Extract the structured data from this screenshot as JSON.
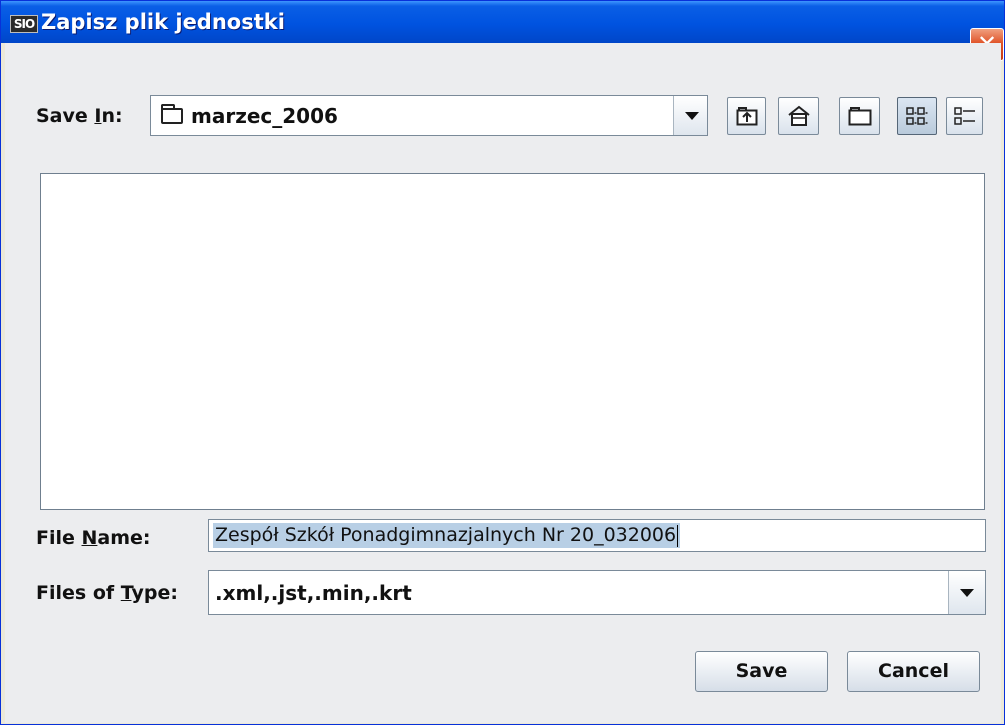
{
  "window": {
    "title": "Zapisz plik jednostki",
    "app_icon_text": "SIO",
    "close_symbol": "✕"
  },
  "save_in": {
    "label_pre": "Save ",
    "label_mnemonic": "I",
    "label_post": "n:",
    "value": "marzec_2006"
  },
  "toolbar": [
    {
      "name": "up-one-level",
      "icon": "folder-up-icon"
    },
    {
      "name": "home",
      "icon": "home-icon"
    },
    {
      "name": "new-folder",
      "icon": "new-folder-icon"
    },
    {
      "name": "list-view",
      "icon": "list-view-icon",
      "toggled": true
    },
    {
      "name": "details-view",
      "icon": "details-view-icon"
    }
  ],
  "file_list": {
    "items": []
  },
  "file_name": {
    "label_pre": "File ",
    "label_mnemonic": "N",
    "label_post": "ame:",
    "value": "Zespół Szkół Ponadgimnazjalnych Nr 20_032006"
  },
  "files_of_type": {
    "label_pre": "Files of ",
    "label_mnemonic": "T",
    "label_post": "ype:",
    "value": ".xml,.jst,.min,.krt"
  },
  "buttons": {
    "save": "Save",
    "cancel": "Cancel"
  }
}
